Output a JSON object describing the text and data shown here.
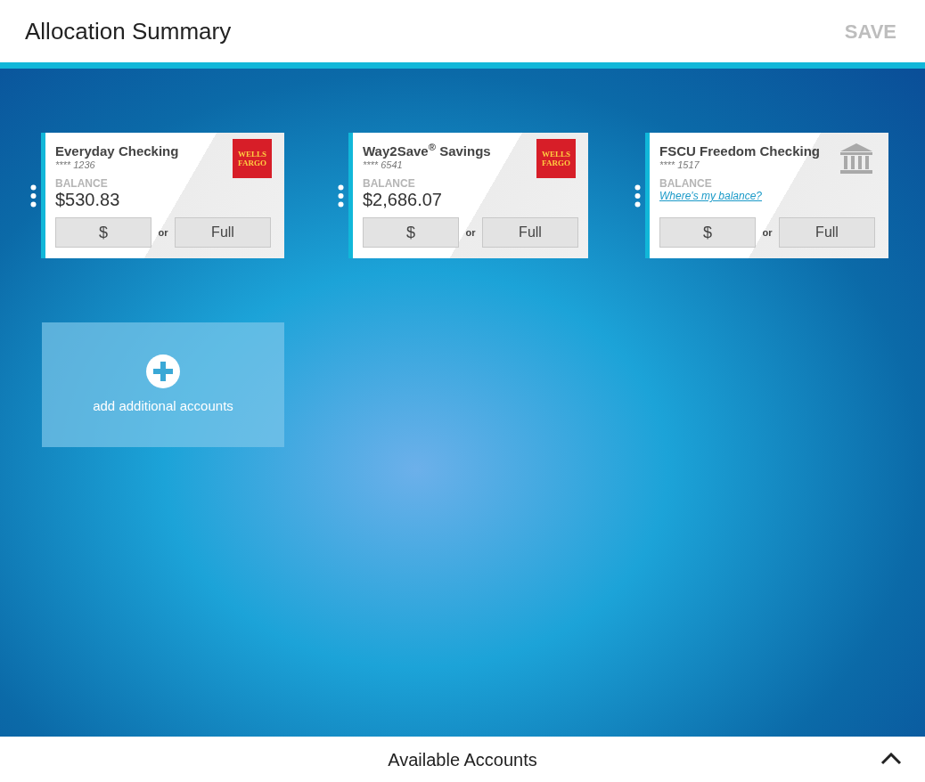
{
  "header": {
    "title": "Allocation Summary",
    "save": "SAVE"
  },
  "accounts": [
    {
      "name": "Everyday Checking",
      "number": "**** 1236",
      "balance_label": "BALANCE",
      "balance": {
        "kind": "amount",
        "text": "$530.83"
      },
      "logo": {
        "kind": "text",
        "text": "WELLS FARGO"
      },
      "amount_button": "$",
      "or": "or",
      "full_button": "Full"
    },
    {
      "name": "Way2Save$^{®}$ Savings",
      "number": "**** 6541",
      "balance_label": "BALANCE",
      "balance": {
        "kind": "amount",
        "text": "$2,686.07"
      },
      "logo": {
        "kind": "text",
        "text": "WELLS FARGO"
      },
      "amount_button": "$",
      "or": "or",
      "full_button": "Full"
    },
    {
      "name": "FSCU Freedom Checking",
      "number": "**** 1517",
      "balance_label": "BALANCE",
      "balance": {
        "kind": "link",
        "text": "Where's my balance?"
      },
      "logo": {
        "kind": "bank"
      },
      "amount_button": "$",
      "or": "or",
      "full_button": "Full"
    }
  ],
  "add_tile": {
    "label": "add additional accounts"
  },
  "footer": {
    "label": "Available Accounts"
  }
}
